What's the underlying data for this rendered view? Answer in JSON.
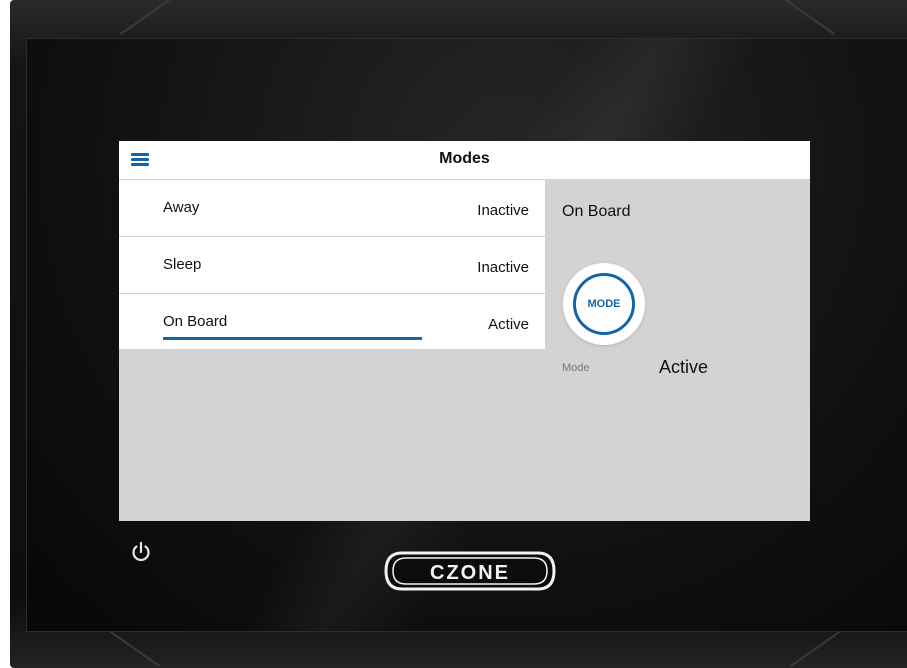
{
  "header": {
    "title": "Modes"
  },
  "modes": [
    {
      "name": "Away",
      "status": "Inactive",
      "selected": false
    },
    {
      "name": "Sleep",
      "status": "Inactive",
      "selected": false
    },
    {
      "name": "On Board",
      "status": "Active",
      "selected": true
    }
  ],
  "detail": {
    "title": "On Board",
    "button_label": "MODE",
    "caption": "Mode",
    "value": "Active"
  },
  "device": {
    "logo_text": "CZONE",
    "power_icon": "power-icon",
    "menu_icon": "hamburger-menu-icon"
  },
  "colors": {
    "accent": "#1565a6",
    "screen_bg": "#d3d3d3",
    "bezel": "#0e0e10"
  }
}
